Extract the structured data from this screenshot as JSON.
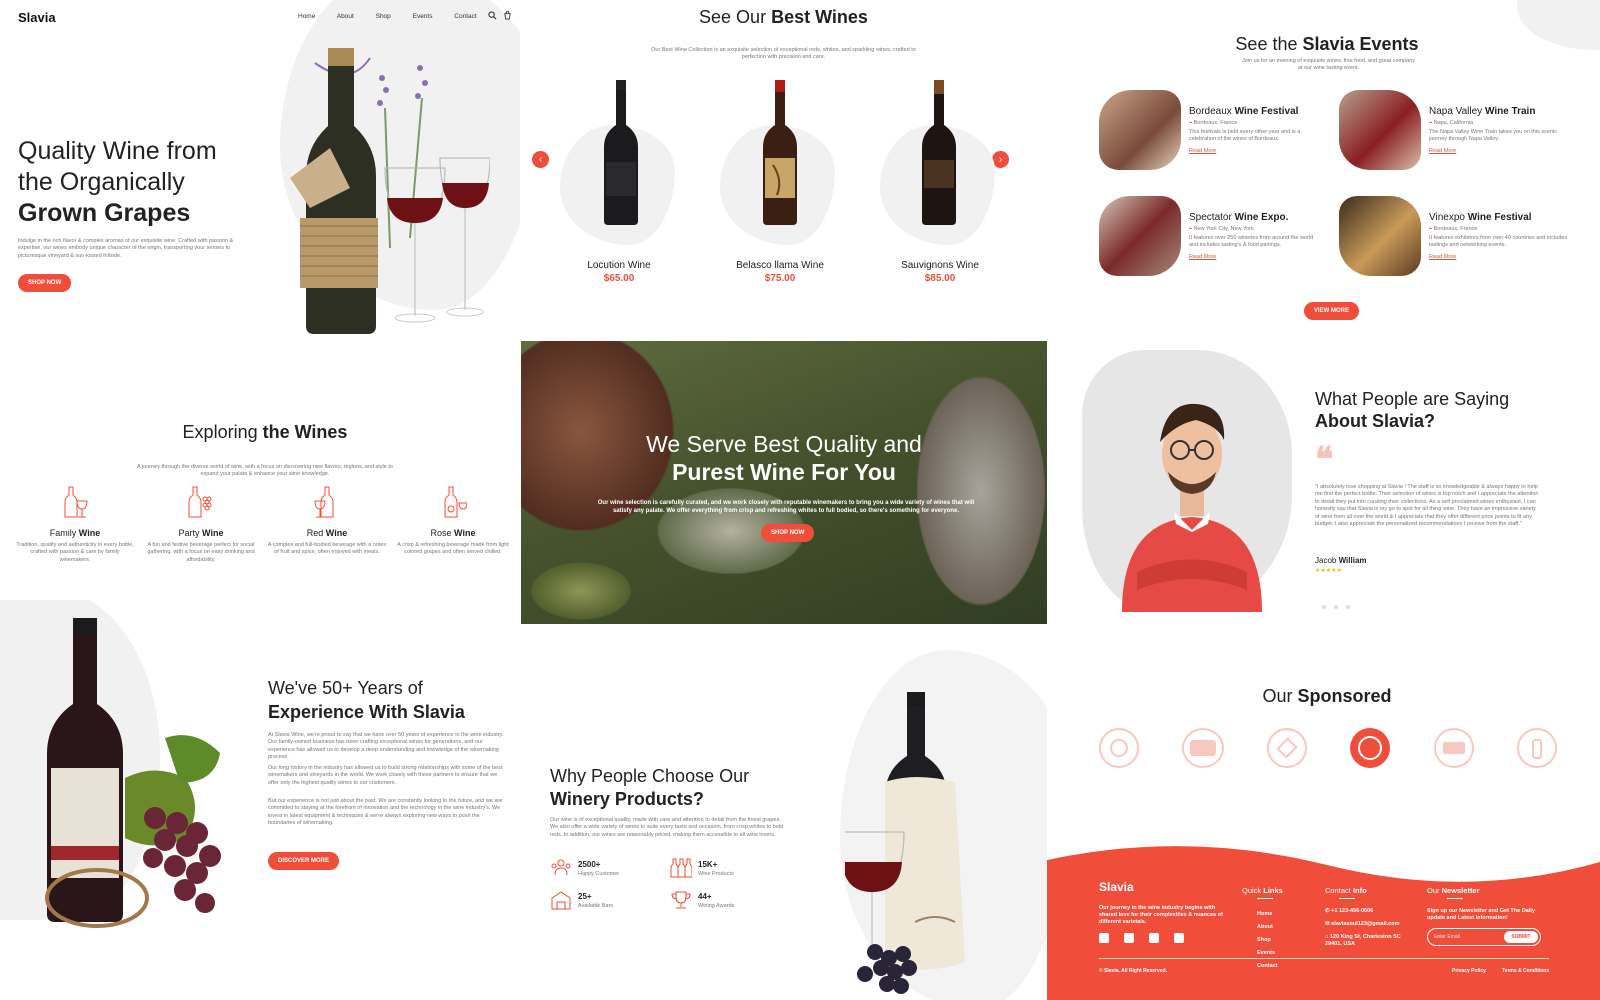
{
  "hero": {
    "logo": "Slavia",
    "nav": [
      "Home",
      "About",
      "Shop",
      "Events",
      "Contact"
    ],
    "title_l1": "Quality Wine from",
    "title_l2": "the Organically",
    "title_l3": "Grown Grapes",
    "desc": "Indulge in the rich flavor & complex aromas of our exquisite wine. Crafted with passion & expertise, our wines embody unique character of the origin, transporting your senses to picturesque vineyard & sun-kissed hillside.",
    "btn": "SHOP NOW"
  },
  "best": {
    "title_a": "See Our ",
    "title_b": "Best Wines",
    "desc": "Our Best Wine Collection is an exquisite selection of exceptional reds, whites, and sparkling wines, crafted to perfection with precision and care.",
    "items": [
      {
        "name": "Locution Wine",
        "price": "$65.00"
      },
      {
        "name": "Belasco llama Wine",
        "price": "$75.00"
      },
      {
        "name": "Sauvignons Wine",
        "price": "$85.00"
      }
    ]
  },
  "events": {
    "title_a": "See the ",
    "title_b": "Slavia Events",
    "desc": "Join us for an evening of exquisite wines, fine food, and great company at our wine tasting event.",
    "items": [
      {
        "a": "Bordeaux ",
        "b": "Wine Festival",
        "loc": "Bordeaux, France",
        "desc": "This festivals is held every other year and is a celebration of the wines of Bordeaux.",
        "link": "Read More"
      },
      {
        "a": "Napa Valley ",
        "b": "Wine Train",
        "loc": "Napa, California",
        "desc": "The Napa Valley Wine Train takes you on this scenic journey through Napa Valley.",
        "link": "Read More"
      },
      {
        "a": "Spectator ",
        "b": "Wine Expo.",
        "loc": "New York City, New York",
        "desc": "It features over 250 wineries from around the world and includes tasting's & food pairings.",
        "link": "Read More"
      },
      {
        "a": "Vinexpo ",
        "b": "Wine Festival",
        "loc": "Bordeaux, France",
        "desc": "It features exhibitors from over 40 countries and includes tastings and networking events.",
        "link": "Read More"
      }
    ],
    "btn": "VIEW MORE"
  },
  "explore": {
    "title_a": "Exploring ",
    "title_b": "the Wines",
    "desc": "A journey through the diverse world of wine, with a focus on discovering new flavors, regions, and style to expand your palate & enhance your wine knowledge.",
    "items": [
      {
        "a": "Family ",
        "b": "Wine",
        "desc": "Tradition, quality and authenticity in every bottle, crafted with passion & care by family winemakers."
      },
      {
        "a": "Party ",
        "b": "Wine",
        "desc": "A fun and festive beverage perfect for social gathering, with a focus on easy drinking and affordability."
      },
      {
        "a": "Red ",
        "b": "Wine",
        "desc": "A complex and full-bodied beverage with a notes of fruit and spice, often enjoyed with meals."
      },
      {
        "a": "Rose ",
        "b": "Wine",
        "desc": "A crisp & refreshing beverage made from light colored grapes and often served chilled."
      }
    ]
  },
  "banner": {
    "l1": "We Serve Best Quality and",
    "l2": "Purest Wine For You",
    "desc": "Our wine selection is carefully curated, and we work closely with reputable winemakers to bring you a wide variety of wines that will satisfy any palate. We offer everything from crisp and refreshing whites to full bodied, so there's something for everyone.",
    "btn": "SHOP NOW"
  },
  "testimonial": {
    "title_l1": "What People are Saying",
    "title_l2": "About Slavia?",
    "quote": "\"I absolutely love shopping at Slavia ! The staff is so knowledgeable & always happy to help me find the perfect bottle. Their selection of wines is top notch and I appreciate the attention to detail they put into curating their collections. As a self proclaimed wines enthusiast, I can honestly say that Slavia is my go to spot for all thing wine. They have an impressive variety of wine from all over the world & I appreciate that they offer different price points to fit any budget. I also appreciate the personalized recommendations I receive from the staff.\"",
    "name_a": "Jacob ",
    "name_b": "William",
    "stars": "★★★★★",
    "rating": 5
  },
  "experience": {
    "title_l1": "We've 50+ Years of",
    "title_l2": "Experience With Slavia",
    "p1": "At Slavia Wine, we're proud to say that we have over 50 years of experience in the wine industry. Our family-owned business has been crafting exceptional wines for generations, and our experience has allowed us to develop a deep understanding and knowledge of the winemaking process.",
    "p2": "Our long history in the industry has allowed us to build strong relationships with some of the best winemakers and vineyards in the world. We work closely with these partners to ensure that we offer only the highest quality wines to our customers.",
    "p3": "But our experience is not just about the past. We are constantly looking to the future, and we are committed to staying at the forefront of innovation and the technology in the wine industry's. We invest in latest equipment & techniques & we're always exploring new ways to push the boundaries of winemaking.",
    "btn": "DISCOVER MORE"
  },
  "why": {
    "title_l1": "Why People Choose Our",
    "title_l2": "Winery Products?",
    "desc": "Our wine is of exceptional quality, made with care and attention to detail from the finest grapes. We also offer a wide variety of wines to suite every taste and occasion, from crisp whites to bold reds. In addition, our wines are reasonably priced, making them accessible to all wine lovers.",
    "stats": [
      {
        "num": "2500+",
        "label": "Happy Customer"
      },
      {
        "num": "15K+",
        "label": "Wine Products"
      },
      {
        "num": "25+",
        "label": "Available Bars"
      },
      {
        "num": "44+",
        "label": "Wining Awards"
      }
    ]
  },
  "sponsored": {
    "title_a": "Our ",
    "title_b": "Sponsored"
  },
  "footer": {
    "logo": "Slavia",
    "about": "Our journey in the wine industry begins with shared love for their complexities & nuances of different varietals.",
    "links_a": "Quick ",
    "links_b": "Links",
    "links": [
      "Home",
      "About",
      "Shop",
      "Events",
      "Contact"
    ],
    "contact_a": "Contact ",
    "contact_b": "Info",
    "phone": "+1 123-456-0606",
    "email": "slaviasoul123@gmail.com",
    "address": "120 King St, Charleston SC 29401, USA",
    "news_a": "Our ",
    "news_b": "Newsletter",
    "news_desc": "Sign up our Newsletter and Get The Daily update and Latest Information!",
    "placeholder": "Enter Email",
    "submit": "SUBMIT",
    "copyright": "© Slavia. All Right Reserved.",
    "privacy": "Privacy Policy",
    "terms": "Terms & Conditions"
  },
  "colors": {
    "accent": "#f04e3a",
    "text": "#222222",
    "muted": "#777777",
    "blob": "#f1f1f1"
  }
}
